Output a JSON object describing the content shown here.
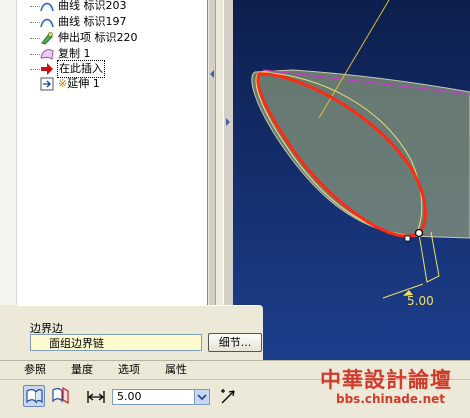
{
  "model_tree": {
    "items": [
      {
        "label": "曲线 标识203",
        "icon": "curve-icon"
      },
      {
        "label": "曲线 标识197",
        "icon": "curve-icon"
      },
      {
        "label": "伸出项 标识220",
        "icon": "protrusion-icon"
      },
      {
        "label": "复制 1",
        "icon": "copy-surface-icon"
      },
      {
        "label": "在此插入",
        "icon": "insert-here-arrow-icon"
      },
      {
        "label": "延伸 1",
        "icon": "extend-feature-icon"
      }
    ]
  },
  "viewport": {
    "dimension_label": "5.00",
    "background_color": "#142d6b",
    "surface_color": "#7e8a72",
    "edge_color": "#ff2a10",
    "curve_color": "#e8e07a",
    "boundary_color": "#c040c0"
  },
  "boundary_panel": {
    "title": "边界边",
    "field_value": "面组边界链",
    "details_button": "细节..."
  },
  "dashboard": {
    "tabs": [
      "参照",
      "量度",
      "选项",
      "属性"
    ],
    "distance_value": "5.00"
  },
  "watermark": {
    "line1": "中華設計論壇",
    "line2": "bbs.chinade.net"
  }
}
